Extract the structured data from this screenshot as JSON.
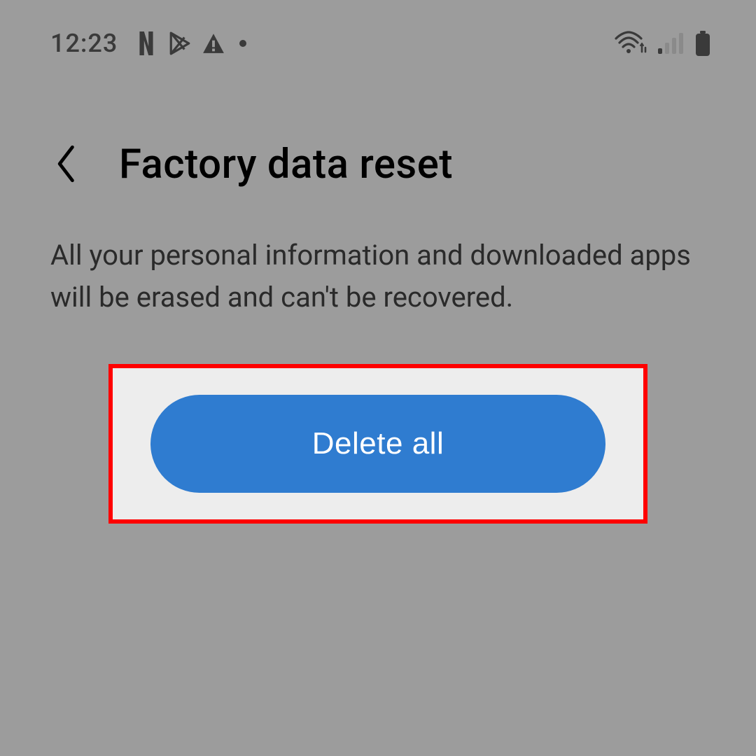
{
  "status_bar": {
    "time": "12:23",
    "notification_icons": [
      "netflix-icon",
      "play-store-icon",
      "warning-icon",
      "more-dot-icon"
    ],
    "system_icons": [
      "wifi-icon",
      "signal-icon",
      "battery-icon"
    ]
  },
  "header": {
    "back_label": "Back",
    "title": "Factory data reset"
  },
  "body": {
    "description": "All your personal information and downloaded apps will be erased and can't be recovered."
  },
  "action": {
    "delete_all_label": "Delete all"
  },
  "highlight": {
    "border_color": "#ff0000",
    "background": "#ededed"
  },
  "colors": {
    "primary_button": "#2f7cd0",
    "status_icon": "#3a3a3a"
  }
}
